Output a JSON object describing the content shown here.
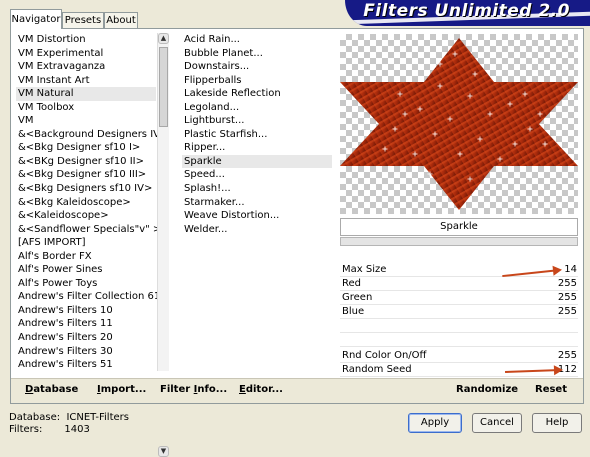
{
  "tabs": [
    {
      "label": "Navigator"
    },
    {
      "label": "Presets"
    },
    {
      "label": "About"
    }
  ],
  "banner": {
    "title": "Filters Unlimited 2.0"
  },
  "categories": [
    "VM Distortion",
    "VM Experimental",
    "VM Extravaganza",
    "VM Instant Art",
    "VM Natural",
    "VM Toolbox",
    "VM",
    "&<Background Designers IV>",
    "&<Bkg Designer sf10 I>",
    "&<BKg Designer sf10 II>",
    "&<Bkg Designer sf10 III>",
    "&<Bkg Designers sf10 IV>",
    "&<Bkg Kaleidoscope>",
    "&<Kaleidoscope>",
    "&<Sandflower Specials\"v\" >",
    "[AFS IMPORT]",
    "Alf's Border FX",
    "Alf's Power Sines",
    "Alf's Power Toys",
    "Andrew's Filter Collection 61",
    "Andrew's Filters 10",
    "Andrew's Filters 11",
    "Andrew's Filters 20",
    "Andrew's Filters 30",
    "Andrew's Filters 51"
  ],
  "categories_selected": 4,
  "filters": [
    "Acid Rain...",
    "Bubble Planet...",
    "Downstairs...",
    "Flipperballs",
    "Lakeside Reflection",
    "Legoland...",
    "Lightburst...",
    "Plastic Starfish...",
    "Ripper...",
    "Sparkle",
    "Speed...",
    "Splash!...",
    "Starmaker...",
    "Weave Distortion...",
    "Welder..."
  ],
  "filters_selected": 9,
  "preview": {
    "filter_name": "Sparkle"
  },
  "params_top": [
    {
      "label": "Max Size",
      "value": "14"
    },
    {
      "label": "Red",
      "value": "255"
    },
    {
      "label": "Green",
      "value": "255"
    },
    {
      "label": "Blue",
      "value": "255"
    }
  ],
  "params_bottom": [
    {
      "label": "Rnd Color On/Off",
      "value": "255"
    },
    {
      "label": "Random Seed",
      "value": "112"
    }
  ],
  "links": {
    "database": {
      "u": "D",
      "rest": "atabase"
    },
    "import": {
      "u": "I",
      "rest": "mport..."
    },
    "filter_info": {
      "pre": "Filter ",
      "u": "I",
      "rest": "nfo..."
    },
    "editor": {
      "u": "E",
      "rest": "ditor..."
    },
    "randomize": "Randomize",
    "reset": "Reset"
  },
  "status": {
    "database_label": "Database:",
    "database_value": "ICNET-Filters",
    "filters_label": "Filters:",
    "filters_value": "1403"
  },
  "buttons": {
    "apply": "Apply",
    "cancel": "Cancel",
    "help": "Help"
  },
  "colors": {
    "banner": "#161a86",
    "arrow": "#c8461a",
    "star_dark": "#7a1a08",
    "star_light": "#d8401a"
  }
}
